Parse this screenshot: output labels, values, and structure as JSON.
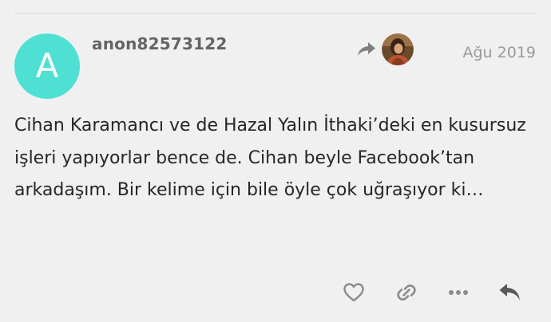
{
  "post": {
    "avatar": {
      "letter": "A",
      "color": "#4fe0d4"
    },
    "username": "anon82573122",
    "reply_to": {
      "arrow_icon": "share-reply-icon",
      "avatar_icon": "user-avatar-photo"
    },
    "date": "Ağu 2019",
    "body": "Cihan Karamancı ve de Hazal Yalın İthaki’deki en kusursuz işleri yapıyorlar bence de. Cihan beyle Facebook’tan arkadaşım. Bir kelime için bile öyle çok uğraşıyor ki…"
  },
  "actions": [
    {
      "name": "like-button",
      "icon": "heart-icon"
    },
    {
      "name": "copy-link-button",
      "icon": "link-icon"
    },
    {
      "name": "more-button",
      "icon": "ellipsis-icon"
    },
    {
      "name": "reply-button",
      "icon": "reply-icon"
    }
  ],
  "colors": {
    "background": "#f0f0f0",
    "username": "#646464",
    "text": "#262626",
    "muted": "#9a9a9a",
    "icon": "#8c8c8c",
    "reply_icon": "#595959"
  }
}
